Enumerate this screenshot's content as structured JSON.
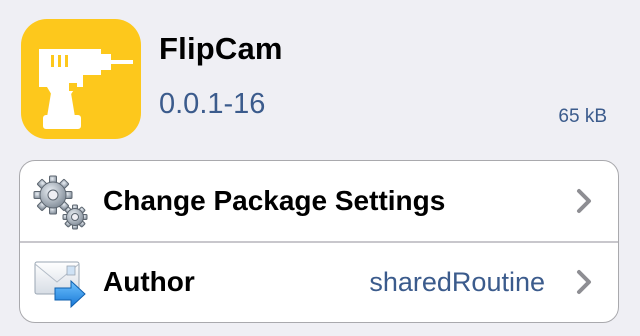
{
  "package": {
    "name": "FlipCam",
    "version": "0.0.1-16",
    "size": "65 kB",
    "icon": "drill-icon",
    "icon_bg": "#fdc81c"
  },
  "rows": [
    {
      "label": "Change Package Settings",
      "value": "",
      "icon": "gears-icon"
    },
    {
      "label": "Author",
      "value": "sharedRoutine",
      "icon": "mail-forward-icon"
    }
  ],
  "colors": {
    "background": "#efeff4",
    "accent_text": "#3b5b8c"
  }
}
